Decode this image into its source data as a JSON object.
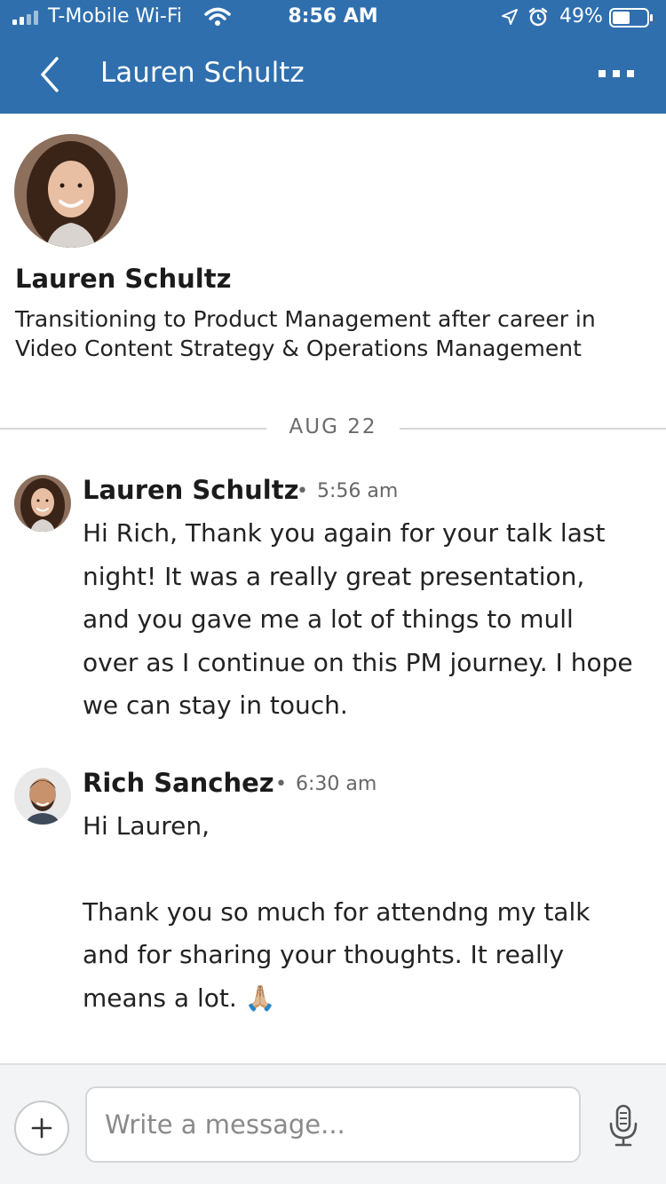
{
  "status_bar": {
    "carrier": "T-Mobile Wi-Fi",
    "time": "8:56 AM",
    "battery_percent": "49%"
  },
  "nav": {
    "title": "Lauren Schultz",
    "icons": [
      "back-chevron-icon",
      "more-options-icon"
    ]
  },
  "profile": {
    "name": "Lauren Schultz",
    "headline": "Transitioning to Product Management after career in Video Content Strategy & Operations Management"
  },
  "date_separator": "AUG 22",
  "messages": [
    {
      "sender": "Lauren Schultz",
      "dot": "•",
      "time": "5:56 am",
      "body": [
        "Hi Rich, Thank you again for your talk last night! It was a really great presentation, and you gave me a lot of things to mull over as I continue on this PM journey. I hope we can stay in touch."
      ]
    },
    {
      "sender": "Rich Sanchez",
      "dot": "•",
      "time": "6:30 am",
      "body": [
        "Hi Lauren,",
        "",
        "Thank you so much for attendng my talk and for sharing your thoughts. It really means a lot. 🙏🏼"
      ]
    }
  ],
  "composer": {
    "placeholder": "Write a message...",
    "icons": [
      "plus-icon",
      "microphone-icon"
    ]
  },
  "colors": {
    "header_blue": "#2f6fae",
    "text_dark": "#1b1b1b",
    "text_muted": "#666666",
    "composer_bg": "#f2f4f6"
  }
}
